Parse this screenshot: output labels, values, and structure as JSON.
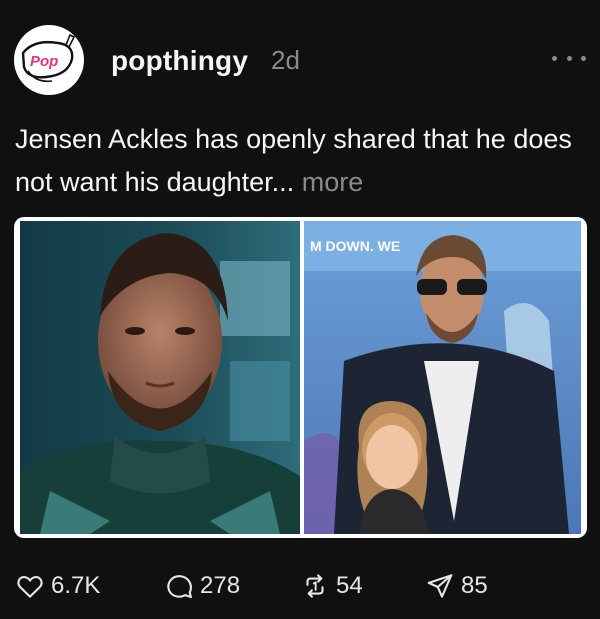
{
  "post": {
    "username": "popthingy",
    "timestamp": "2d",
    "avatar_text": "Pop",
    "caption": "Jensen Ackles has openly shared that he does not want his daughter...",
    "more_label": "more",
    "images": [
      {
        "icon": "portrait-photo",
        "overlay_text": ""
      },
      {
        "icon": "red-carpet-photo",
        "overlay_text": "M DOWN. WE"
      }
    ]
  },
  "actions": {
    "likes": "6.7K",
    "comments": "278",
    "reposts": "54",
    "shares": "85"
  },
  "colors": {
    "background": "#101010",
    "text": "#f3f5f7",
    "muted": "#8a8a8a",
    "brand_pink": "#e8337a"
  }
}
